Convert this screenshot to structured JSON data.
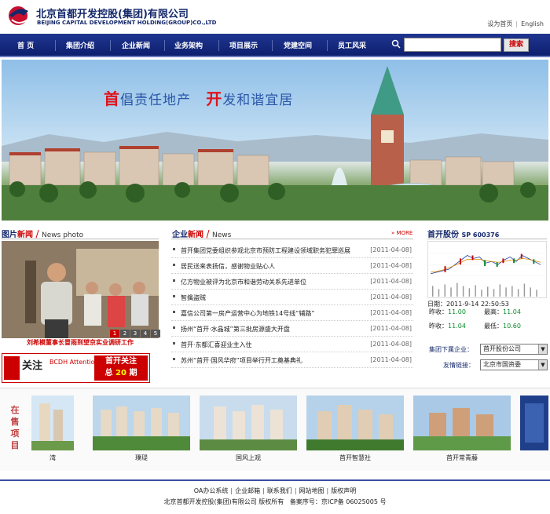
{
  "header": {
    "company_cn": "北京首都开发控股(集团)有限公司",
    "company_en": "BEIJING CAPITAL DEVELOPMENT HOLDING(GROUP)CO.,LTD",
    "set_home": "设为首页",
    "english": "English"
  },
  "nav": {
    "items": [
      "首 页",
      "集团介绍",
      "企业新闻",
      "业务架构",
      "项目展示",
      "党建空间",
      "员工风采"
    ],
    "search_placeholder": "",
    "search_button": "搜索"
  },
  "banner": {
    "slogan_a_big": "首",
    "slogan_a": "倡责任地产",
    "slogan_b_big": "开",
    "slogan_b": "发和谐宜居"
  },
  "photo_news": {
    "title_red": "图片",
    "title_blue": "新闻",
    "subtitle": "News photo",
    "caption": "刘希模董事长冒雨到望京实业调研工作",
    "pages": [
      "1",
      "2",
      "3",
      "4",
      "5"
    ],
    "active_page": 1,
    "ad_left": "关注",
    "ad_right_1": "首开关注",
    "ad_right_2_a": "总",
    "ad_right_2_num": "20",
    "ad_right_2_b": "期",
    "ad_en": "BCDH Attention"
  },
  "news": {
    "title_red": "企业",
    "title_blue": "新闻",
    "subtitle": "News",
    "more": "MORE",
    "items": [
      {
        "title": "首开集团党委组织参观北京市预防工程建设领域职务犯罪巡展",
        "date": "[2011-04-08]"
      },
      {
        "title": "居民送来表扬信，感谢物业贴心人",
        "date": "[2011-04-08]"
      },
      {
        "title": "亿方物业被评为北京市和谐劳动关系先进单位",
        "date": "[2011-04-08]"
      },
      {
        "title": "智擒盗贼",
        "date": "[2011-04-08]"
      },
      {
        "title": "嘉信公司第一房产运营中心为地铁14号线“辅路”",
        "date": "[2011-04-08]"
      },
      {
        "title": "扬州“首开·水晶城”第三批房源盛大开盘",
        "date": "[2011-04-08]"
      },
      {
        "title": "首开·东都汇喜迎业主入住",
        "date": "[2011-04-08]"
      },
      {
        "title": "苏州“首开·国风华府”项目举行开工奠基典礼",
        "date": "[2011-04-08]"
      }
    ]
  },
  "stock": {
    "title": "首开股份",
    "code": "SP 600376",
    "date_label": "日期：",
    "date_value": "2011-9-14 22:50:53",
    "now_label": "昨收：",
    "now_value": "11.00",
    "high_label": "最高：",
    "high_value": "11.04",
    "prev_label": "昨收：",
    "prev_value": "11.04",
    "low_label": "最低：",
    "low_value": "10.60",
    "subsidiary_label": "集团下属企业：",
    "subsidiary_value": "首开股份公司",
    "friend_label": "友情链接：",
    "friend_value": "北京市国资委"
  },
  "projects": {
    "label": "在售项目",
    "items": [
      {
        "name": "璞瑅"
      },
      {
        "name": "国风上观"
      },
      {
        "name": "首开智慧社"
      },
      {
        "name": "首开常青藤"
      }
    ],
    "partial_left": "湾"
  },
  "footer": {
    "links": [
      "OA办公系统",
      "企业邮箱",
      "联系我们",
      "网站地图",
      "版权声明"
    ],
    "copyright": "北京首都开发控股(集团)有限公司 版权所有",
    "icp": "备案序号：京ICP备 06025005 号"
  },
  "colors": {
    "nav_bg": "#14286b",
    "accent_red": "#e0131b",
    "brand_blue": "#14286b"
  }
}
